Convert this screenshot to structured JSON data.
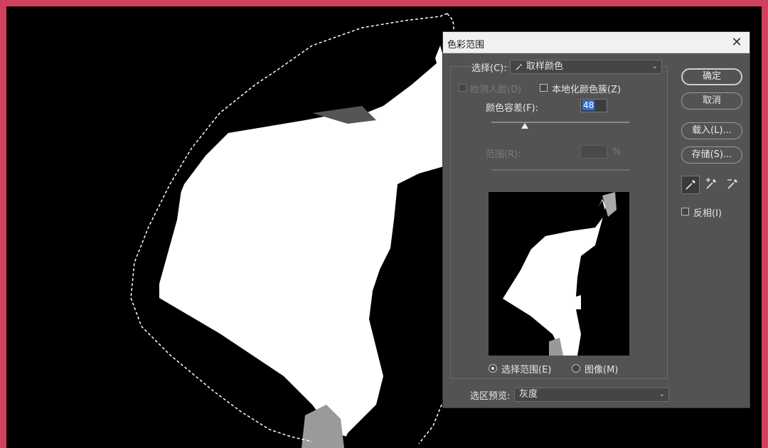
{
  "dialog": {
    "title": "色彩范围",
    "select_label": "选择(C):",
    "select_value": "取样颜色",
    "detect_faces": "检测人脸(D)",
    "localized_clusters": "本地化颜色簇(Z)",
    "fuzziness_label": "颜色容差(F):",
    "fuzziness_value": "48",
    "fuzziness_level": 0.24,
    "range_label": "范围(R):",
    "range_unit": "%",
    "radio_selection": "选择范围(E)",
    "radio_image": "图像(M)",
    "selected_radio": "选择范围(E)",
    "preview_label": "选区预览:",
    "preview_value": "灰度"
  },
  "buttons": {
    "ok": "确定",
    "cancel": "取消",
    "load": "载入(L)...",
    "save": "存储(S)..."
  },
  "tools": {
    "icons": [
      "eyedropper-icon",
      "eyedropper-plus-icon",
      "eyedropper-minus-icon"
    ],
    "active": "eyedropper-icon",
    "invert": "反相(I)"
  },
  "colors": {
    "frame": "#d2405f",
    "dialog_bg": "#535353",
    "title_bg": "#f1f1f1",
    "highlight": "#2f6ed8"
  }
}
